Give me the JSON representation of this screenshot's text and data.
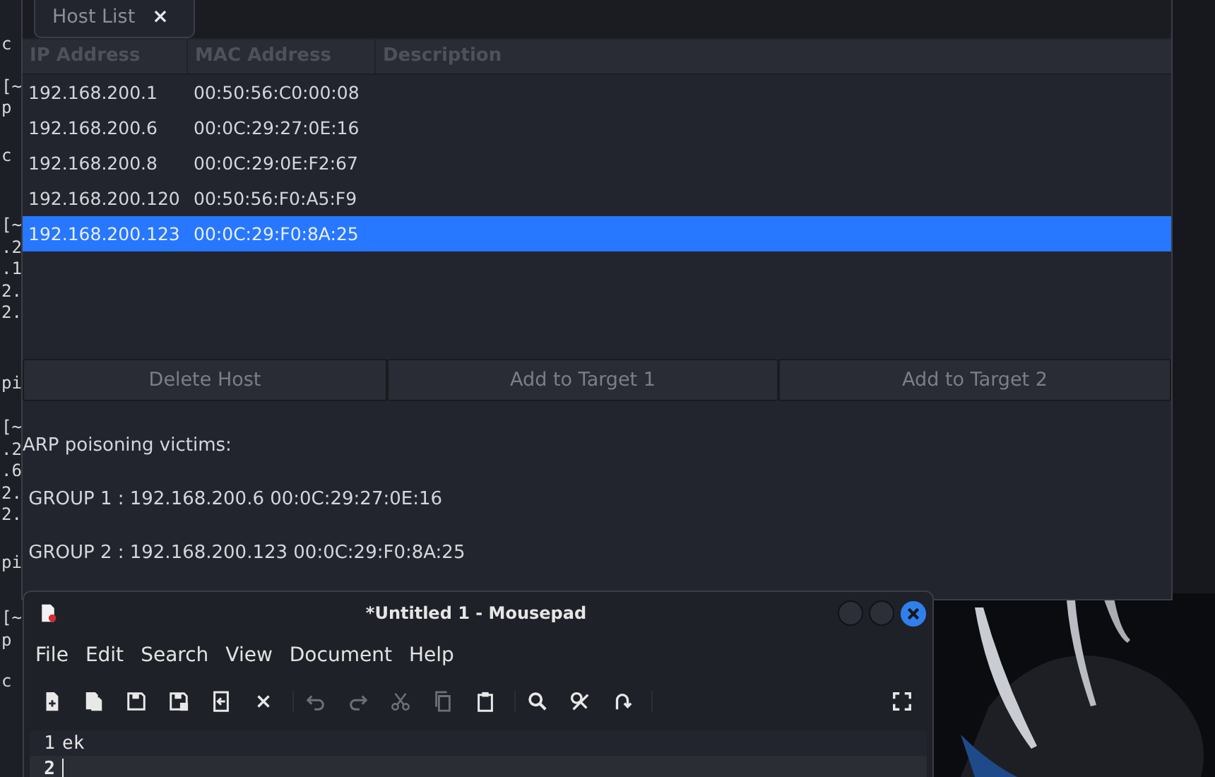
{
  "terminal": {
    "groups": [
      [
        "c"
      ],
      [
        "[~",
        "p"
      ],
      [
        "c"
      ],
      [
        "[~",
        ".2",
        ".1",
        "2.",
        "2."
      ],
      [
        "pi"
      ],
      [
        "[~",
        ".2",
        ".6",
        "2.",
        "2."
      ],
      [
        "pi"
      ],
      [
        "[~",
        "p"
      ],
      [
        "c"
      ]
    ]
  },
  "main_window": {
    "tabs": [
      {
        "label": "Host List",
        "close": "×",
        "selected": true
      }
    ],
    "table": {
      "columns": [
        "IP Address",
        "MAC Address",
        "Description"
      ],
      "rows": [
        {
          "ip": "192.168.200.1",
          "mac": "00:50:56:C0:00:08",
          "selected": false
        },
        {
          "ip": "192.168.200.6",
          "mac": "00:0C:29:27:0E:16",
          "selected": false
        },
        {
          "ip": "192.168.200.8",
          "mac": "00:0C:29:0E:F2:67",
          "selected": false
        },
        {
          "ip": "192.168.200.120",
          "mac": "00:50:56:F0:A5:F9",
          "selected": false
        },
        {
          "ip": "192.168.200.123",
          "mac": "00:0C:29:F0:8A:25",
          "selected": true
        }
      ]
    },
    "buttons": [
      "Delete Host",
      "Add to Target 1",
      "Add to Target 2"
    ],
    "log": [
      "ARP poisoning victims:",
      " GROUP 1 : 192.168.200.6 00:0C:29:27:0E:16",
      " GROUP 2 : 192.168.200.123 00:0C:29:F0:8A:25"
    ]
  },
  "editor_window": {
    "title": "*Untitled 1 - Mousepad",
    "menu": [
      "File",
      "Edit",
      "Search",
      "View",
      "Document",
      "Help"
    ],
    "toolbar": [
      [
        {
          "kind": "new",
          "disabled": false
        },
        {
          "kind": "new-window",
          "disabled": false
        },
        {
          "kind": "save",
          "disabled": false
        },
        {
          "kind": "save-as",
          "disabled": false
        },
        {
          "kind": "revert",
          "disabled": false
        },
        {
          "kind": "close",
          "disabled": false
        }
      ],
      [
        {
          "kind": "undo",
          "disabled": true
        },
        {
          "kind": "redo",
          "disabled": true
        },
        {
          "kind": "cut",
          "disabled": true
        },
        {
          "kind": "copy",
          "disabled": true
        },
        {
          "kind": "paste",
          "disabled": false
        }
      ],
      [
        {
          "kind": "find",
          "disabled": false
        },
        {
          "kind": "replace",
          "disabled": false
        },
        {
          "kind": "goto",
          "disabled": false
        }
      ],
      [
        {
          "kind": "fullscreen",
          "disabled": false
        }
      ]
    ],
    "lines": [
      {
        "number": "1",
        "text": "ek",
        "current": false
      },
      {
        "number": "2",
        "current": true
      }
    ]
  }
}
